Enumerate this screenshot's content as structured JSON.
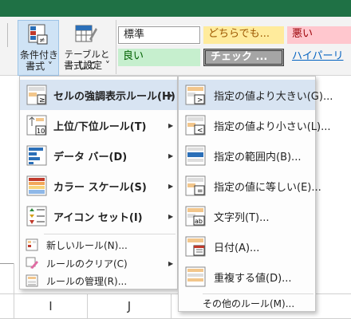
{
  "ribbon": {
    "conditional_format_label": "条件付き\n書式 ˅",
    "conditional_format_line1": "条件付き",
    "conditional_format_line2": "書式 ˅",
    "table_format_line1": "テーブルとして",
    "table_format_line2": "書式設定 ˅",
    "styles": {
      "normal": "標準",
      "neutral": "どちらでも...",
      "bad": "悪い",
      "good": "良い",
      "check": "チェック ...",
      "hyperlink": "ハイパーリ"
    }
  },
  "main_menu": {
    "items": [
      {
        "label": "セルの強調表示ルール(H)",
        "icon": "highlight-rules-icon",
        "has_submenu": true,
        "selected": true
      },
      {
        "label": "上位/下位ルール(T)",
        "icon": "top-bottom-rules-icon",
        "has_submenu": true
      },
      {
        "label": "データ バー(D)",
        "icon": "data-bars-icon",
        "has_submenu": true
      },
      {
        "label": "カラー スケール(S)",
        "icon": "color-scales-icon",
        "has_submenu": true
      },
      {
        "label": "アイコン セット(I)",
        "icon": "icon-sets-icon",
        "has_submenu": true
      }
    ],
    "small_items": [
      {
        "label": "新しいルール(N)...",
        "icon": "new-rule-icon",
        "has_submenu": false
      },
      {
        "label": "ルールのクリア(C)",
        "icon": "clear-rules-icon",
        "has_submenu": true
      },
      {
        "label": "ルールの管理(R)...",
        "icon": "manage-rules-icon",
        "has_submenu": false
      }
    ]
  },
  "submenu": {
    "items": [
      {
        "label": "指定の値より大きい(G)...",
        "icon": "greater-than-icon",
        "selected": true
      },
      {
        "label": "指定の値より小さい(L)...",
        "icon": "less-than-icon"
      },
      {
        "label": "指定の範囲内(B)...",
        "icon": "between-icon"
      },
      {
        "label": "指定の値に等しい(E)...",
        "icon": "equal-to-icon"
      },
      {
        "label": "文字列(T)...",
        "icon": "text-contains-icon"
      },
      {
        "label": "日付(A)...",
        "icon": "date-occurring-icon"
      },
      {
        "label": "重複する値(D)...",
        "icon": "duplicate-values-icon"
      }
    ],
    "more_rules": "その他のルール(M)..."
  },
  "columns": [
    "I",
    "J"
  ],
  "colors": {
    "accent": "#1f7145",
    "selected": "#d8e4f2"
  }
}
